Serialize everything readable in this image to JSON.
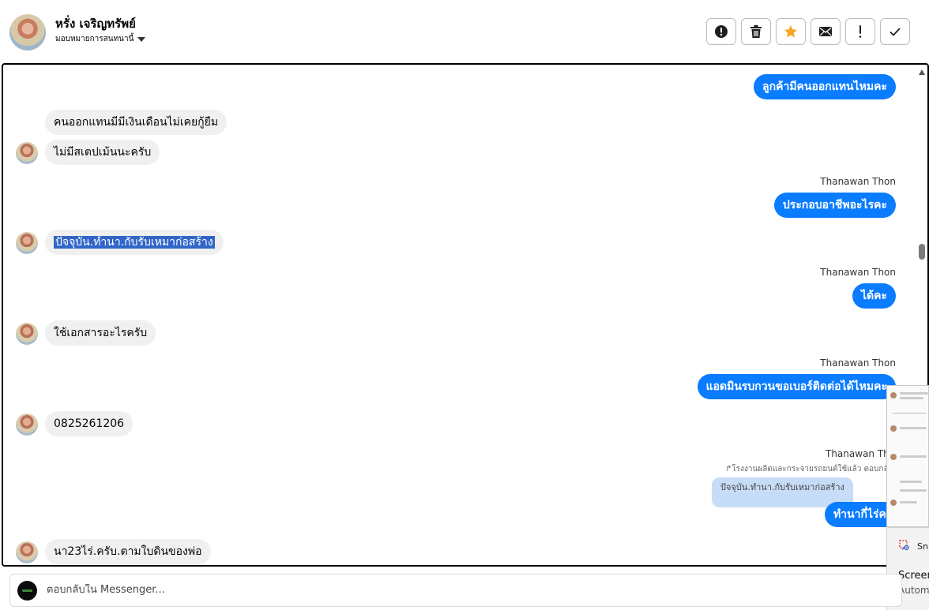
{
  "header": {
    "contact_name": "หรั่ง เจริญทรัพย์",
    "assign_label": "มอบหมายการสนทนานี้"
  },
  "toolbar": {
    "buttons": [
      {
        "name": "report-spam",
        "icon": "alert-circle-icon"
      },
      {
        "name": "delete",
        "icon": "trash-icon"
      },
      {
        "name": "star",
        "icon": "star-icon",
        "color": "#f5a623"
      },
      {
        "name": "mark-unread",
        "icon": "envelope-icon"
      },
      {
        "name": "follow-up",
        "icon": "exclamation-icon"
      },
      {
        "name": "mark-done",
        "icon": "check-icon"
      }
    ]
  },
  "messages": [
    {
      "direction": "out",
      "text": "ลูกค้ามีคนออกแทนไหมคะ"
    },
    {
      "direction": "in",
      "text": "คนออกแทนมีมีเงินเดือนไม่เคยกู้ยืม"
    },
    {
      "direction": "in",
      "text": "ไม่มีสเตปเม้นนะครับ"
    },
    {
      "direction": "out",
      "sender": "Thanawan Thon",
      "text": "ประกอบอาชีพอะไรคะ"
    },
    {
      "direction": "in",
      "text": "ปัจจุบัน.ทำนา.กับรับเหมาก่อสร้าง",
      "selected": true
    },
    {
      "direction": "out",
      "sender": "Thanawan Thon",
      "text": "ได้คะ"
    },
    {
      "direction": "in",
      "text": "ใช้เอกสารอะไรครับ"
    },
    {
      "direction": "out",
      "sender": "Thanawan Thon",
      "text": "แอดมินรบกวนขอเบอร์ติดต่อได้ไหมคะ"
    },
    {
      "direction": "in",
      "text": "0825261206"
    },
    {
      "direction": "out",
      "sender": "Thanawan Tho",
      "reply_meta": "โรงงานผลิตและกระจายรถยนต์ใช้แล้ว ตอบกลับ",
      "reply_quote": "ปัจจุบัน.ทำนา.กับรับเหมาก่อสร้าง",
      "text": "ทำนากี่ไร่คะ"
    },
    {
      "direction": "in",
      "text": "นา23ไร่.ครับ.ตามใบดินของพ่อ"
    }
  ],
  "composer": {
    "placeholder": "ตอบกลับใน Messenger..."
  },
  "snipping_tool": {
    "label": "Sni",
    "title": "Screen",
    "subtitle": "Autom"
  },
  "colors": {
    "outgoing_bubble": "#0a7cff",
    "incoming_bubble": "#f0f0f0",
    "selection": "#3166c8"
  }
}
